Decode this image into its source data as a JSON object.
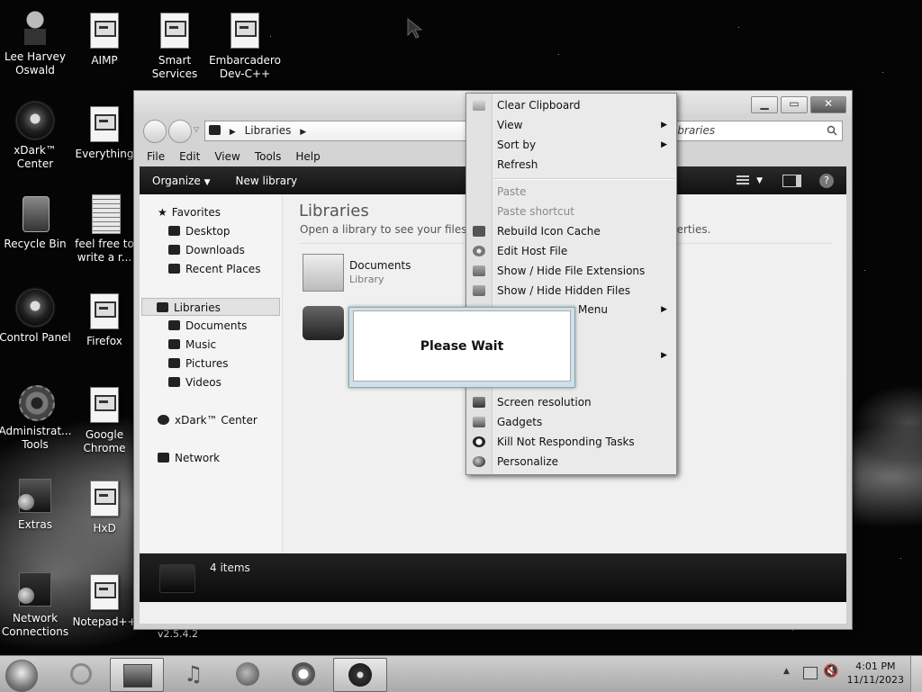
{
  "desktop_icons": [
    {
      "label": "Lee Harvey Oswald",
      "icon": "figure-icon"
    },
    {
      "label": "AIMP",
      "icon": "aimp-icon"
    },
    {
      "label": "Smart Services",
      "icon": "smart-services-icon"
    },
    {
      "label": "Embarcadero Dev-C++",
      "icon": "dev-cpp-icon"
    },
    {
      "label": "xDark™ Center",
      "icon": "xdark-center-icon"
    },
    {
      "label": "Everything",
      "icon": "everything-icon"
    },
    {
      "label": "Recycle Bin",
      "icon": "recycle-bin-icon"
    },
    {
      "label": "feel free to write a r...",
      "icon": "text-document-icon"
    },
    {
      "label": "Control Panel",
      "icon": "control-panel-icon"
    },
    {
      "label": "Firefox",
      "icon": "firefox-icon"
    },
    {
      "label": "Administrat... Tools",
      "icon": "admin-tools-icon"
    },
    {
      "label": "Google Chrome",
      "icon": "chrome-icon"
    },
    {
      "label": "Extras",
      "icon": "extras-icon"
    },
    {
      "label": "HxD",
      "icon": "hxd-icon"
    },
    {
      "label": "Network Connections",
      "icon": "network-connections-icon"
    },
    {
      "label": "Notepad++",
      "icon": "notepad-plus-icon"
    }
  ],
  "version_text": "v2.5.4.2",
  "explorer": {
    "address_segments": [
      "Libraries"
    ],
    "search_placeholder": "Search Libraries",
    "search_visible": "ibraries",
    "menu": [
      "File",
      "Edit",
      "View",
      "Tools",
      "Help"
    ],
    "toolbar": {
      "organize": "Organize",
      "new_library": "New library"
    },
    "nav": {
      "favorites": "Favorites",
      "favorites_items": [
        "Desktop",
        "Downloads",
        "Recent Places"
      ],
      "libraries": "Libraries",
      "libraries_items": [
        "Documents",
        "Music",
        "Pictures",
        "Videos"
      ],
      "xdark": "xDark™ Center",
      "network": "Network"
    },
    "content": {
      "title": "Libraries",
      "subtitle": "Open a library to see your files and",
      "subtitle_right": "perties.",
      "items": [
        {
          "name": "Documents",
          "type": "Library"
        }
      ]
    },
    "status": "4 items"
  },
  "context_menu": [
    {
      "label": "Clear Clipboard",
      "icon": "clipboard-icon"
    },
    {
      "label": "View",
      "submenu": true
    },
    {
      "label": "Sort by",
      "submenu": true
    },
    {
      "label": "Refresh"
    },
    {
      "label": "Paste",
      "disabled": true
    },
    {
      "label": "Paste shortcut",
      "disabled": true
    },
    {
      "label": "Rebuild Icon Cache",
      "icon": "rebuild-icon"
    },
    {
      "label": "Edit Host File",
      "icon": "gear-icon"
    },
    {
      "label": "Show / Hide File Extensions",
      "icon": "shield-icon"
    },
    {
      "label": "Show / Hide Hidden Files",
      "icon": "shield-icon"
    },
    {
      "label": "Menu",
      "submenu": true
    },
    {
      "label": "Screen resolution",
      "icon": "monitor-icon"
    },
    {
      "label": "Gadgets",
      "icon": "gadgets-icon"
    },
    {
      "label": "Kill Not Responding Tasks",
      "icon": "kill-icon"
    },
    {
      "label": "Personalize",
      "icon": "personalize-icon"
    }
  ],
  "dialog": {
    "text": "Please Wait"
  },
  "taskbar": {
    "time": "4:01 PM",
    "date": "11/11/2023",
    "apps": [
      "start-orb",
      "internet-explorer-icon",
      "explorer-icon",
      "media-player-icon",
      "firefox-icon",
      "chrome-icon",
      "xdark-icon"
    ]
  }
}
